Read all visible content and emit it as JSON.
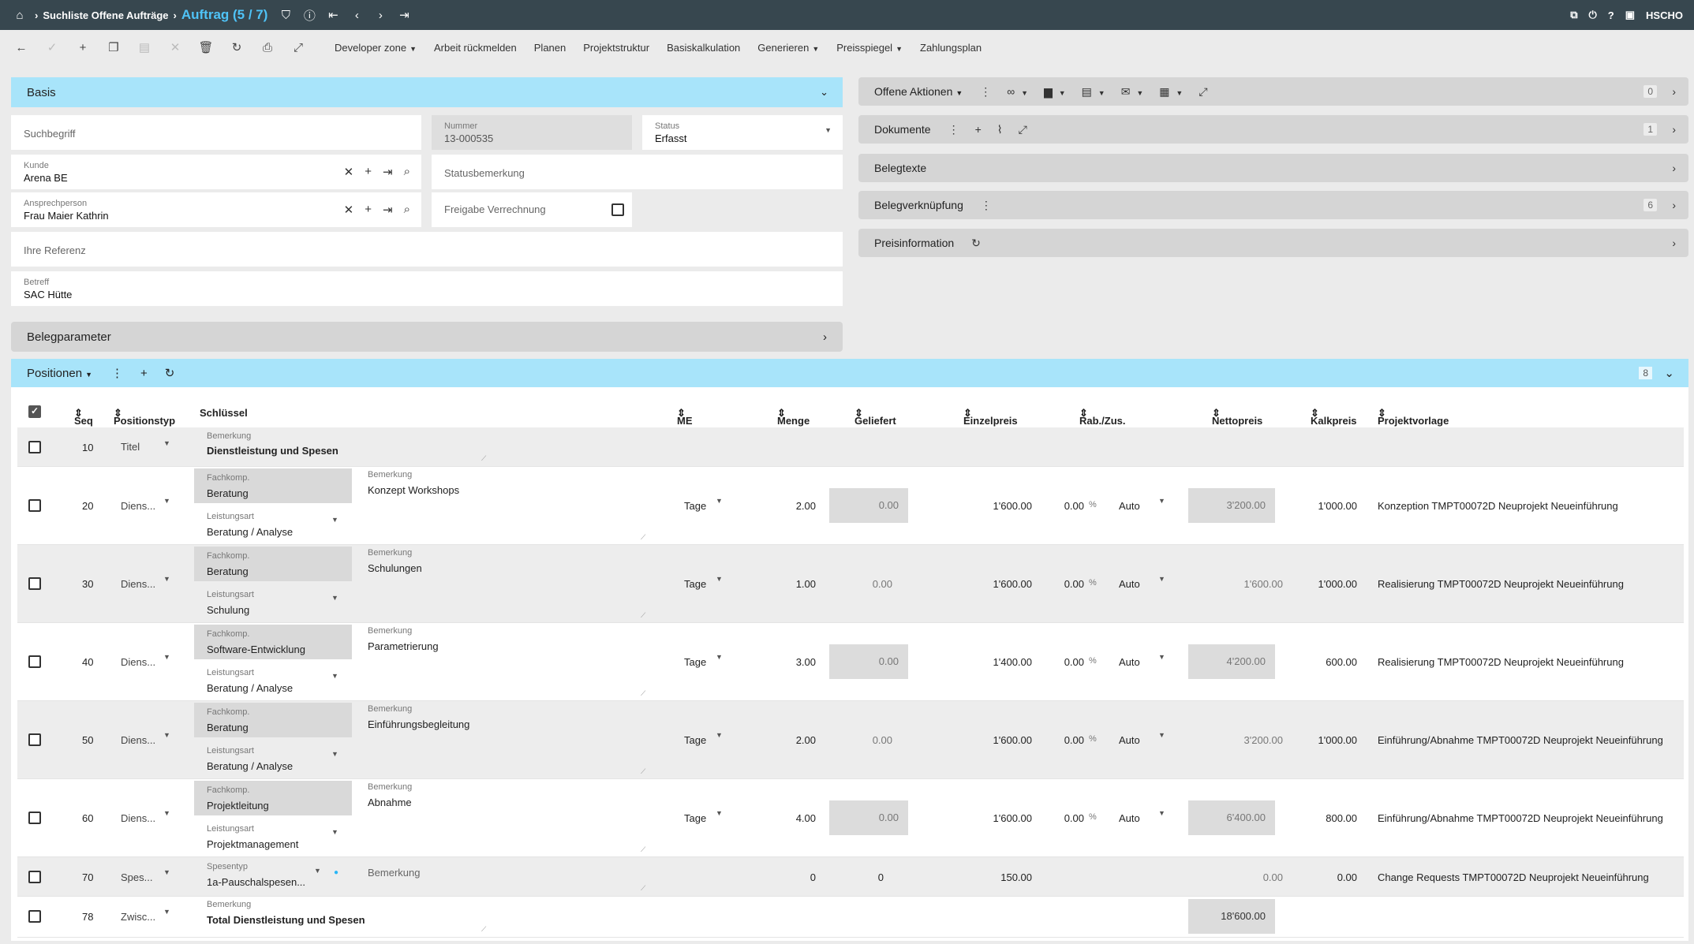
{
  "topbar": {
    "breadcrumb": "Suchliste Offene Aufträge",
    "title": "Auftrag (5 / 7)",
    "user": "HSCHO"
  },
  "toolbar": {
    "items": [
      "Developer zone",
      "Arbeit rückmelden",
      "Planen",
      "Projektstruktur",
      "Basiskalkulation",
      "Generieren",
      "Preisspiegel",
      "Zahlungsplan"
    ]
  },
  "basis": {
    "header": "Basis",
    "suchbegriff_ph": "Suchbegriff",
    "nummer_label": "Nummer",
    "nummer_value": "13-000535",
    "status_label": "Status",
    "status_value": "Erfasst",
    "kunde_label": "Kunde",
    "kunde_value": "Arena  BE",
    "statusbemerkung_ph": "Statusbemerkung",
    "ansprech_label": "Ansprechperson",
    "ansprech_value": "Frau Maier Kathrin",
    "freigabe_label": "Freigabe Verrechnung",
    "referenz_ph": "Ihre Referenz",
    "betreff_label": "Betreff",
    "betreff_value": "SAC Hütte",
    "belegparameter": "Belegparameter"
  },
  "right_panels": {
    "offene": "Offene Aktionen",
    "offene_count": "0",
    "dokumente": "Dokumente",
    "dokumente_count": "1",
    "belegtexte": "Belegtexte",
    "verknuepfung": "Belegverknüpfung",
    "verknuepfung_count": "6",
    "preisinfo": "Preisinformation"
  },
  "positionen": {
    "header": "Positionen",
    "count": "8",
    "columns": {
      "seq": "Seq",
      "typ": "Positionstyp",
      "schluessel": "Schlüssel",
      "me": "ME",
      "menge": "Menge",
      "geliefert": "Geliefert",
      "einzelpreis": "Einzelpreis",
      "rab": "Rab./Zus.",
      "netto": "Nettopreis",
      "kalk": "Kalkpreis",
      "vorlage": "Projektvorlage"
    },
    "labels": {
      "bemerkung": "Bemerkung",
      "fachkomp": "Fachkomp.",
      "leistungsart": "Leistungsart",
      "spesentyp": "Spesentyp",
      "pct": "%"
    },
    "rows": [
      {
        "seq": "10",
        "typ": "Titel",
        "bemerkung": "Dienstleistung und Spesen"
      },
      {
        "seq": "20",
        "typ": "Diens...",
        "fachkomp": "Beratung",
        "leistungsart": "Beratung / Analyse",
        "bemerkung": "Konzept Workshops",
        "me": "Tage",
        "menge": "2.00",
        "geliefert": "0.00",
        "einzelpreis": "1'600.00",
        "rab": "0.00",
        "auto": "Auto",
        "netto": "3'200.00",
        "kalk": "1'000.00",
        "vorlage": "Konzeption TMPT00072D Neuprojekt Neueinführung"
      },
      {
        "seq": "30",
        "typ": "Diens...",
        "fachkomp": "Beratung",
        "leistungsart": "Schulung",
        "bemerkung": "Schulungen",
        "me": "Tage",
        "menge": "1.00",
        "geliefert": "0.00",
        "einzelpreis": "1'600.00",
        "rab": "0.00",
        "auto": "Auto",
        "netto": "1'600.00",
        "kalk": "1'000.00",
        "vorlage": "Realisierung TMPT00072D Neuprojekt Neueinführung"
      },
      {
        "seq": "40",
        "typ": "Diens...",
        "fachkomp": "Software-Entwicklung",
        "leistungsart": "Beratung / Analyse",
        "bemerkung": "Parametrierung",
        "me": "Tage",
        "menge": "3.00",
        "geliefert": "0.00",
        "einzelpreis": "1'400.00",
        "rab": "0.00",
        "auto": "Auto",
        "netto": "4'200.00",
        "kalk": "600.00",
        "vorlage": "Realisierung TMPT00072D Neuprojekt Neueinführung"
      },
      {
        "seq": "50",
        "typ": "Diens...",
        "fachkomp": "Beratung",
        "leistungsart": "Beratung / Analyse",
        "bemerkung": "Einführungsbegleitung",
        "me": "Tage",
        "menge": "2.00",
        "geliefert": "0.00",
        "einzelpreis": "1'600.00",
        "rab": "0.00",
        "auto": "Auto",
        "netto": "3'200.00",
        "kalk": "1'000.00",
        "vorlage": "Einführung/Abnahme TMPT00072D Neuprojekt Neueinführung"
      },
      {
        "seq": "60",
        "typ": "Diens...",
        "fachkomp": "Projektleitung",
        "leistungsart": "Projektmanagement",
        "bemerkung": "Abnahme",
        "me": "Tage",
        "menge": "4.00",
        "geliefert": "0.00",
        "einzelpreis": "1'600.00",
        "rab": "0.00",
        "auto": "Auto",
        "netto": "6'400.00",
        "kalk": "800.00",
        "vorlage": "Einführung/Abnahme TMPT00072D Neuprojekt Neueinführung"
      },
      {
        "seq": "70",
        "typ": "Spes...",
        "spesentyp": "1a-Pauschalspesen...",
        "bemerkung_ph": "Bemerkung",
        "menge": "0",
        "geliefert": "0",
        "einzelpreis": "150.00",
        "netto": "0.00",
        "kalk": "0.00",
        "vorlage": "Change Requests TMPT00072D Neuprojekt Neueinführung"
      },
      {
        "seq": "78",
        "typ": "Zwisc...",
        "bemerkung": "Total Dienstleistung und Spesen",
        "netto": "18'600.00"
      }
    ]
  }
}
